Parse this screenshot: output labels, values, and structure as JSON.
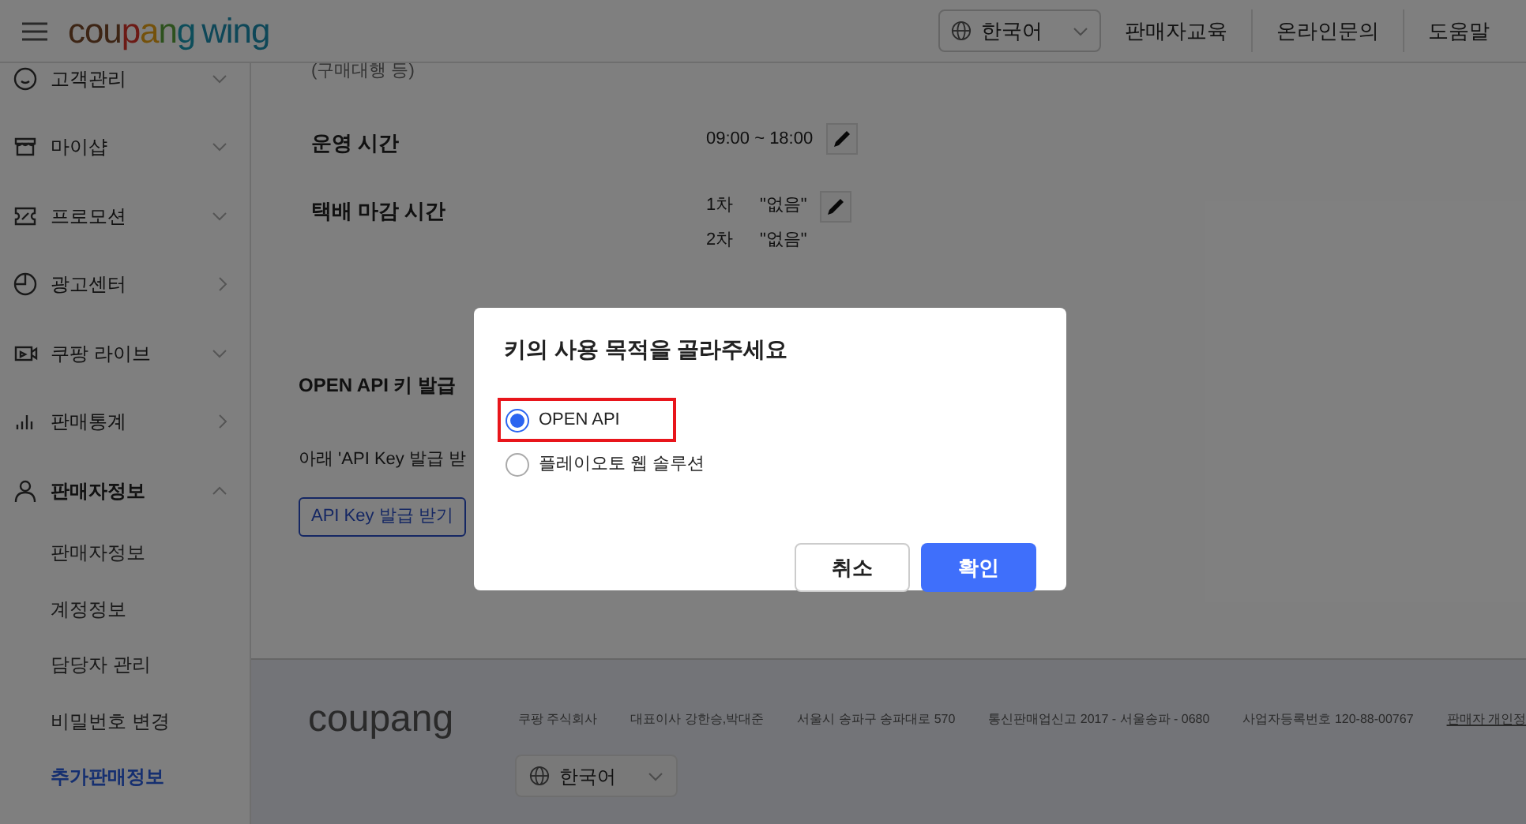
{
  "header": {
    "logo": {
      "brand": "coupang",
      "product": "wing"
    },
    "language": "한국어",
    "links": [
      "판매자교육",
      "온라인문의",
      "도움말"
    ]
  },
  "sidebar": {
    "items": [
      {
        "label": "고객관리",
        "kind": "group",
        "expanded": false
      },
      {
        "label": "마이샵",
        "kind": "group",
        "expanded": false
      },
      {
        "label": "프로모션",
        "kind": "group",
        "expanded": false
      },
      {
        "label": "광고센터",
        "kind": "link",
        "expanded": false
      },
      {
        "label": "쿠팡 라이브",
        "kind": "group",
        "expanded": false
      },
      {
        "label": "판매통계",
        "kind": "link",
        "expanded": false
      },
      {
        "label": "판매자정보",
        "kind": "group",
        "expanded": true,
        "children": [
          {
            "label": "판매자정보",
            "selected": false
          },
          {
            "label": "계정정보",
            "selected": false
          },
          {
            "label": "담당자 관리",
            "selected": false
          },
          {
            "label": "비밀번호 변경",
            "selected": false
          },
          {
            "label": "추가판매정보",
            "selected": true
          }
        ]
      }
    ]
  },
  "content": {
    "note": "(구매대행 등)",
    "rows": [
      {
        "label": "운영 시간",
        "values": [
          {
            "value": "09:00 ~ 18:00",
            "editable": true
          }
        ]
      },
      {
        "label": "택배 마감 시간",
        "values": [
          {
            "prefix": "1차",
            "value": "\"없음\"",
            "editable": true
          },
          {
            "prefix": "2차",
            "value": "\"없음\"",
            "editable": false
          }
        ]
      }
    ],
    "api_section": {
      "title": "OPEN API 키 발급",
      "description": "아래 'API Key 발급 받",
      "button": "API Key 발급 받기"
    }
  },
  "footer": {
    "logo": "coupang",
    "info": [
      "쿠팡 주식회사",
      "대표이사 강한승,박대준",
      "서울시 송파구 송파대로 570",
      "통신판매업신고 2017 - 서울송파 - 0680",
      "사업자등록번호 120-88-00767"
    ],
    "link": "판매자 개인정",
    "language": "한국어"
  },
  "dialog": {
    "title": "키의 사용 목적을 골라주세요",
    "options": [
      {
        "label": "OPEN API",
        "selected": true,
        "highlighted": true
      },
      {
        "label": "플레이오토 웹 솔루션",
        "selected": false,
        "highlighted": false
      }
    ],
    "buttons": [
      {
        "label": "취소",
        "kind": "secondary"
      },
      {
        "label": "확인",
        "kind": "primary"
      }
    ]
  }
}
